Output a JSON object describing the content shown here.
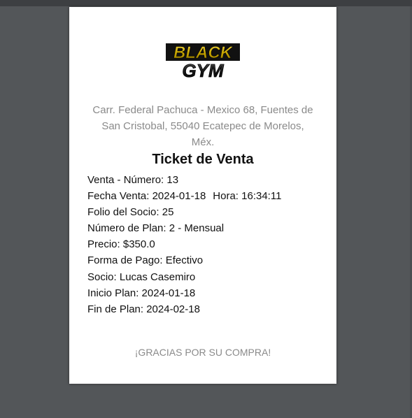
{
  "logo": {
    "line1": "BLACK",
    "line2": "GYM",
    "colors": {
      "gold": "#c9a700",
      "black": "#111111"
    }
  },
  "address": {
    "line1": "Carr. Federal Pachuca - Mexico 68, Fuentes de",
    "line2": "San Cristobal, 55040 Ecatepec de Morelos,",
    "line3": "Méx."
  },
  "ticket": {
    "title": "Ticket de Venta",
    "venta_numero": "Venta - Número: 13",
    "fecha_venta": "Fecha Venta: 2024-01-18",
    "hora": "Hora: 16:34:11",
    "folio_socio": "Folio del Socio: 25",
    "numero_plan": "Número de Plan: 2 - Mensual",
    "precio": "Precio: $350.0",
    "forma_pago": "Forma de Pago: Efectivo",
    "socio": "Socio: Lucas Casemiro",
    "inicio_plan": "Inicio Plan: 2024-01-18",
    "fin_plan": "Fin de Plan: 2024-02-18"
  },
  "footer": {
    "thanks": "¡GRACIAS POR SU COMPRA!"
  }
}
